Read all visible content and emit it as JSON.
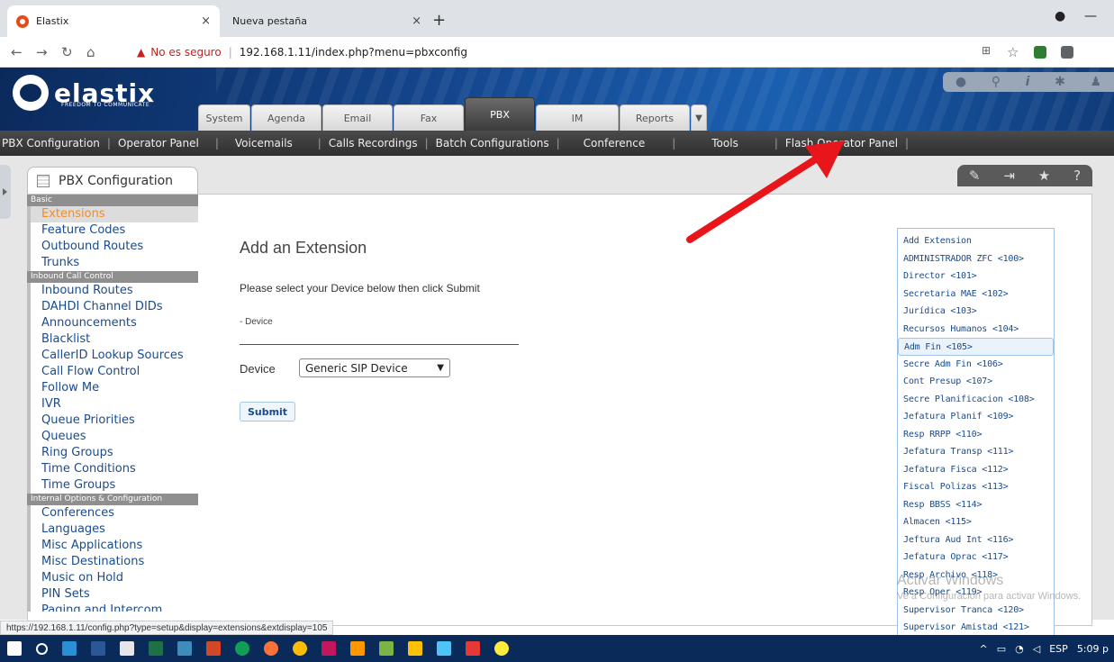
{
  "browser": {
    "tabs": [
      {
        "title": "Elastix",
        "close": "×"
      },
      {
        "title": "Nueva pestaña",
        "close": "×"
      }
    ],
    "new_tab": "+",
    "security_label": "No es seguro",
    "url": "192.168.1.11/index.php?menu=pbxconfig",
    "status_url": "https://192.168.1.11/config.php?type=setup&display=extensions&extdisplay=105"
  },
  "app": {
    "tagline": "FREEDOM TO COMMUNICATE",
    "main_tabs": [
      "System",
      "Agenda",
      "Email",
      "Fax",
      "PBX",
      "IM",
      "Reports"
    ],
    "active_main_tab": "PBX",
    "sub_nav": [
      "PBX Configuration",
      "Operator Panel",
      "Voicemails",
      "Calls Recordings",
      "Batch Configurations",
      "Conference",
      "Tools",
      "Flash Operator Panel"
    ],
    "module_title": "PBX Configuration"
  },
  "left_menu": {
    "sections": [
      {
        "heading": "Basic",
        "items": [
          "Extensions",
          "Feature Codes",
          "Outbound Routes",
          "Trunks"
        ]
      },
      {
        "heading": "Inbound Call Control",
        "items": [
          "Inbound Routes",
          "DAHDI Channel DIDs",
          "Announcements",
          "Blacklist",
          "CallerID Lookup Sources",
          "Call Flow Control",
          "Follow Me",
          "IVR",
          "Queue Priorities",
          "Queues",
          "Ring Groups",
          "Time Conditions",
          "Time Groups"
        ]
      },
      {
        "heading": "Internal Options & Configuration",
        "items": [
          "Conferences",
          "Languages",
          "Misc Applications",
          "Misc Destinations",
          "Music on Hold",
          "PIN Sets",
          "Paging and Intercom"
        ]
      }
    ],
    "active_item": "Extensions"
  },
  "form": {
    "title": "Add an Extension",
    "instructions": "Please select your Device below then click Submit",
    "section_label": "- Device",
    "device_label": "Device",
    "device_value": "Generic SIP Device",
    "submit_label": "Submit"
  },
  "extensions": {
    "items": [
      "Add Extension",
      "ADMINISTRADOR ZFC <100>",
      "Director <101>",
      "Secretaria MAE <102>",
      "Jurídica <103>",
      "Recursos Humanos <104>",
      "Adm Fin <105>",
      "Secre Adm Fin <106>",
      "Cont Presup <107>",
      "Secre Planificacion <108>",
      "Jefatura Planif <109>",
      "Resp RRPP <110>",
      "Jefatura Transp <111>",
      "Jefatura Fisca <112>",
      "Fiscal Polizas <113>",
      "Resp BBSS <114>",
      "Almacen <115>",
      "Jeftura Aud Int <116>",
      "Jefatura Oprac <117>",
      "Resp Archivo <118>",
      "Resp Oper <119>",
      "Supervisor Tranca <120>",
      "Supervisor Amistad <121>"
    ],
    "selected": "Adm Fin <105>"
  },
  "watermark": {
    "line1": "Activar Windows",
    "line2": "Ve a Configuración para activar Windows."
  },
  "taskbar": {
    "lang": "ESP",
    "time": "5:09 p"
  },
  "colors": {
    "accent_orange": "#f28c28",
    "link_blue": "#1a4b8c",
    "arrow_red": "#e8161b",
    "header_blue": "#14468e"
  }
}
